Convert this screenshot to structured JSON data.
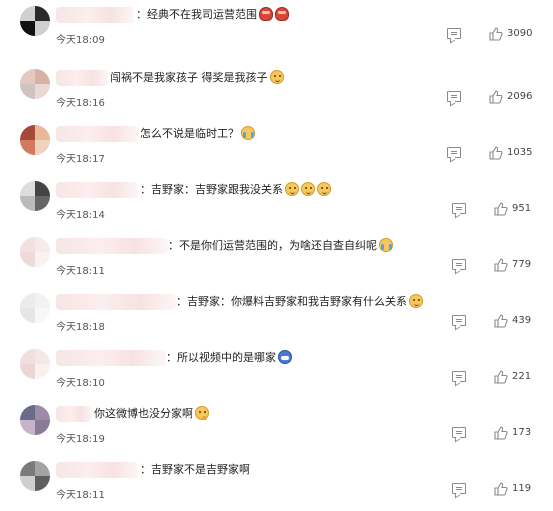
{
  "comments": [
    {
      "text": "：经典不在我司运营范围",
      "emoji": [
        "pot",
        "pot"
      ],
      "time": "今天18:09",
      "likes": "3090",
      "avatar": [
        "#d0d0d0",
        "#2a2a2a",
        "#111111",
        "#cfcfcf"
      ]
    },
    {
      "text": "闯祸不是我家孩子 得奖是我孩子",
      "emoji": [
        "cat"
      ],
      "time": "今天18:16",
      "likes": "2096",
      "avatar": [
        "#e5c9c0",
        "#d8b1a6",
        "#cfc2c2",
        "#ead8d3"
      ]
    },
    {
      "text": "怎么不说是临时工？",
      "emoji": [
        "cry"
      ],
      "time": "今天18:17",
      "likes": "1035",
      "avatar": [
        "#a34a3a",
        "#e8b897",
        "#d37a5c",
        "#f2d2be"
      ]
    },
    {
      "text": "：吉野家：吉野家跟我没关系",
      "emoji": [
        "cat",
        "cat",
        "cat"
      ],
      "time": "今天18:14",
      "likes": "951",
      "avatar": [
        "#dddddd",
        "#444444",
        "#bbbbbb",
        "#666666"
      ]
    },
    {
      "text": "：不是你们运营范围的，为啥还自查自纠呢",
      "emoji": [
        "cry"
      ],
      "time": "今天18:11",
      "likes": "779",
      "avatar": [
        "#f3e0e0",
        "#f8eaea",
        "#efdada",
        "#fbf1f1"
      ]
    },
    {
      "text": "：吉野家：你爆料吉野家和我吉野家有什么关系",
      "emoji": [
        "cat"
      ],
      "time": "今天18:18",
      "likes": "439",
      "avatar": [
        "#ececec",
        "#f2f2f2",
        "#e6e6e6",
        "#f7f7f7"
      ]
    },
    {
      "text": "：所以视频中的是哪家",
      "emoji": [
        "blue"
      ],
      "time": "今天18:10",
      "likes": "221",
      "avatar": [
        "#f2dede",
        "#f7e8e8",
        "#eed5d5",
        "#fbf0f0"
      ]
    },
    {
      "text": "你这微博也没分家啊",
      "emoji": [
        "think"
      ],
      "time": "今天18:19",
      "likes": "173",
      "avatar": [
        "#6a6a8a",
        "#9b8ca8",
        "#c8b4c8",
        "#8a7a9a"
      ]
    },
    {
      "text": "：吉野家不是吉野家啊",
      "emoji": [],
      "time": "今天18:11",
      "likes": "119",
      "avatar": [
        "#7a7a7a",
        "#a3a3a3",
        "#cfcfcf",
        "#5e5e5e"
      ]
    }
  ]
}
